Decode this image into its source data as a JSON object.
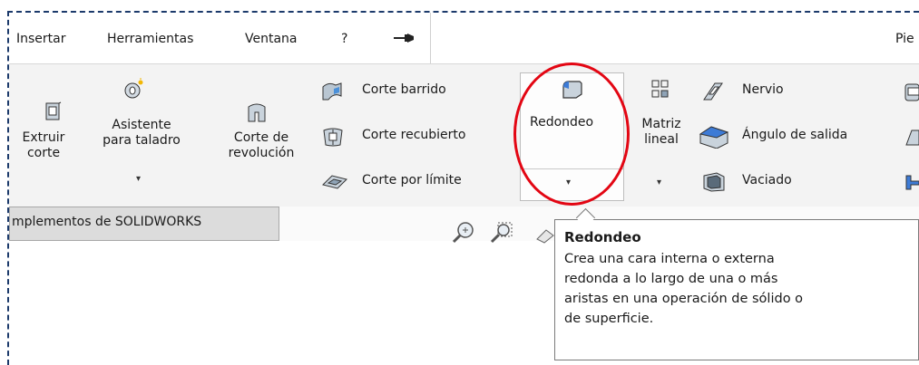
{
  "menubar": {
    "items": [
      "Insertar",
      "Herramientas",
      "Ventana",
      "?"
    ],
    "right_label": "Pie"
  },
  "ribbon": {
    "extruir_corte": [
      "Extruir",
      "corte"
    ],
    "asistente": [
      "Asistente",
      "para taladro"
    ],
    "corte_revolucion": [
      "Corte de",
      "revolución"
    ],
    "corte_barrido": "Corte barrido",
    "corte_recubierto": "Corte recubierto",
    "corte_limite": "Corte por límite",
    "redondeo": "Redondeo",
    "matriz_lineal": [
      "Matriz",
      "lineal"
    ],
    "nervio": "Nervio",
    "angulo_salida": "Ángulo de salida",
    "vaciado": "Vaciado",
    "dropdown_arrow": "▾"
  },
  "tabs": {
    "active": "mplementos de SOLIDWORKS"
  },
  "tooltip": {
    "title": "Redondeo",
    "lines": [
      "Crea una cara interna o externa",
      "redonda a lo largo de una o más",
      "aristas en una operación de sólido o",
      "de superficie."
    ]
  },
  "colors": {
    "highlight_ellipse": "#e30613",
    "dashed_border": "#1c3a6b"
  }
}
